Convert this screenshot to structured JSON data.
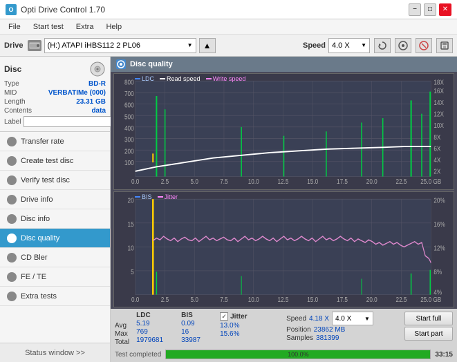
{
  "titlebar": {
    "title": "Opti Drive Control 1.70",
    "icon": "O",
    "minimize": "−",
    "maximize": "□",
    "close": "✕"
  },
  "menubar": {
    "items": [
      "File",
      "Start test",
      "Extra",
      "Help"
    ]
  },
  "drivetoolbar": {
    "drive_label": "Drive",
    "drive_value": "(H:) ATAPI iHBS112  2 PL06",
    "speed_label": "Speed",
    "speed_value": "4.0 X",
    "chevron": "▼"
  },
  "sidebar": {
    "disc_section": "Disc",
    "disc_info": {
      "type_label": "Type",
      "type_val": "BD-R",
      "mid_label": "MID",
      "mid_val": "VERBATIMe (000)",
      "length_label": "Length",
      "length_val": "23.31 GB",
      "contents_label": "Contents",
      "contents_val": "data",
      "label_label": "Label",
      "label_val": ""
    },
    "items": [
      {
        "id": "transfer-rate",
        "label": "Transfer rate",
        "active": false
      },
      {
        "id": "create-test-disc",
        "label": "Create test disc",
        "active": false
      },
      {
        "id": "verify-test-disc",
        "label": "Verify test disc",
        "active": false
      },
      {
        "id": "drive-info",
        "label": "Drive info",
        "active": false
      },
      {
        "id": "disc-info",
        "label": "Disc info",
        "active": false
      },
      {
        "id": "disc-quality",
        "label": "Disc quality",
        "active": true
      },
      {
        "id": "cd-bler",
        "label": "CD Bler",
        "active": false
      },
      {
        "id": "fe-te",
        "label": "FE / TE",
        "active": false
      },
      {
        "id": "extra-tests",
        "label": "Extra tests",
        "active": false
      }
    ],
    "status_window": "Status window >>"
  },
  "disc_quality": {
    "title": "Disc quality",
    "legend1": [
      {
        "label": "LDC",
        "color": "#4488ff"
      },
      {
        "label": "Read speed",
        "color": "#ffffff"
      },
      {
        "label": "Write speed",
        "color": "#ff88ff"
      }
    ],
    "legend2": [
      {
        "label": "BIS",
        "color": "#4488ff"
      },
      {
        "label": "Jitter",
        "color": "#ff88ff"
      }
    ],
    "chart1": {
      "y_left": [
        "800",
        "700",
        "600",
        "500",
        "400",
        "300",
        "200",
        "100"
      ],
      "y_right": [
        "18X",
        "16X",
        "14X",
        "12X",
        "10X",
        "8X",
        "6X",
        "4X",
        "2X"
      ],
      "x_labels": [
        "0.0",
        "2.5",
        "5.0",
        "7.5",
        "10.0",
        "12.5",
        "15.0",
        "17.5",
        "20.0",
        "22.5",
        "25.0 GB"
      ]
    },
    "chart2": {
      "y_left": [
        "20",
        "15",
        "10",
        "5"
      ],
      "y_right": [
        "20%",
        "16%",
        "12%",
        "8%",
        "4%"
      ],
      "x_labels": [
        "0.0",
        "2.5",
        "5.0",
        "7.5",
        "10.0",
        "12.5",
        "15.0",
        "17.5",
        "20.0",
        "22.5",
        "25.0 GB"
      ]
    }
  },
  "stats": {
    "col_headers": [
      "",
      "LDC",
      "BIS"
    ],
    "avg_label": "Avg",
    "avg_ldc": "5.19",
    "avg_bis": "0.09",
    "max_label": "Max",
    "max_ldc": "769",
    "max_bis": "16",
    "total_label": "Total",
    "total_ldc": "1979681",
    "total_bis": "33987",
    "jitter_label": "Jitter",
    "jitter_avg": "13.0%",
    "jitter_max": "15.6%",
    "jitter_check": "✓",
    "speed_label": "Speed",
    "speed_val": "4.18 X",
    "speed_select": "4.0 X",
    "position_label": "Position",
    "position_val": "23862 MB",
    "samples_label": "Samples",
    "samples_val": "381399",
    "start_full": "Start full",
    "start_part": "Start part",
    "progress_pct": "100.0%",
    "progress_width": "100",
    "status": "Test completed",
    "time": "33:15"
  }
}
